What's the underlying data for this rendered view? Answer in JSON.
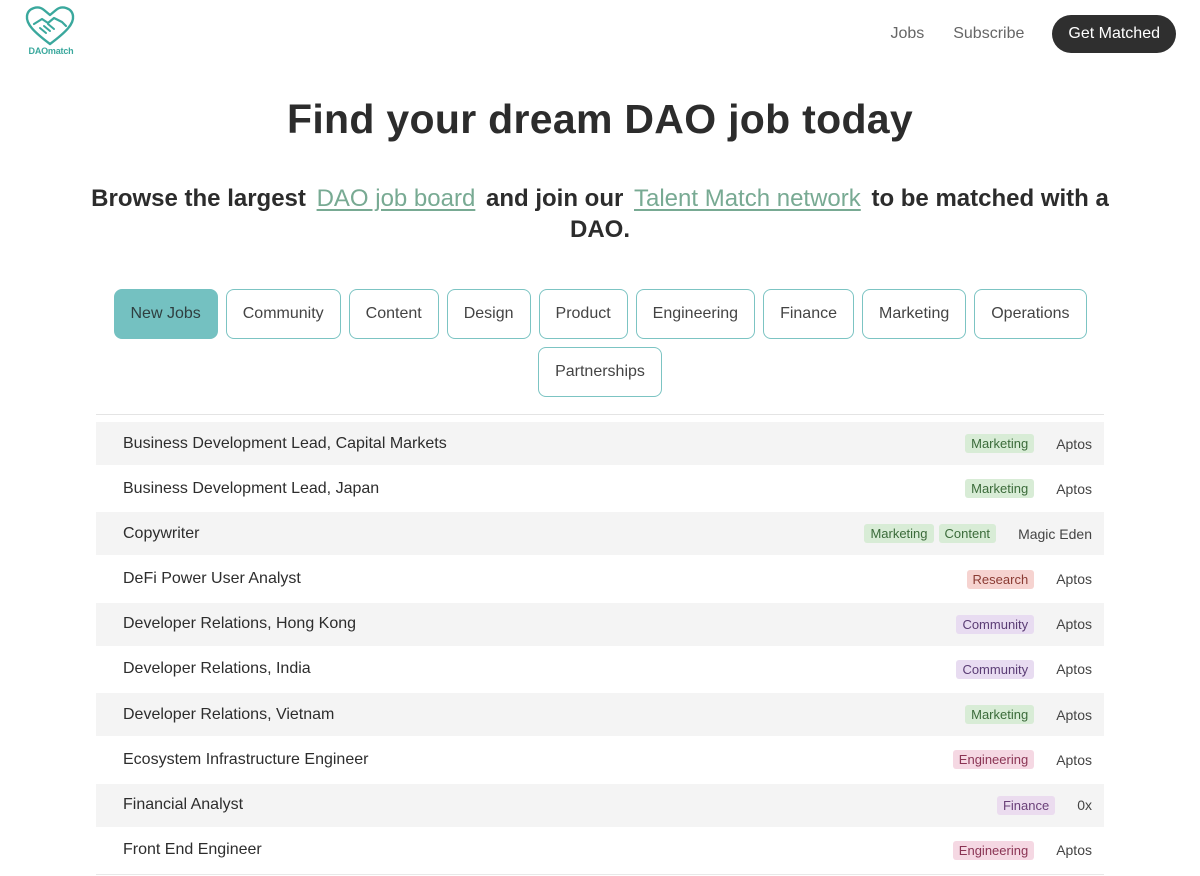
{
  "header": {
    "logo_text": "DAOmatch",
    "nav": [
      {
        "label": "Jobs"
      },
      {
        "label": "Subscribe"
      }
    ],
    "cta_label": "Get Matched"
  },
  "hero": {
    "title": "Find your dream DAO job today",
    "subtitle_part1": "Browse the largest",
    "link1": "DAO job board",
    "subtitle_part2": "and join our",
    "link2": "Talent Match network",
    "subtitle_part3": "to be matched with a DAO."
  },
  "filters": [
    {
      "label": "New Jobs",
      "active": true
    },
    {
      "label": "Community"
    },
    {
      "label": "Content"
    },
    {
      "label": "Design"
    },
    {
      "label": "Product"
    },
    {
      "label": "Engineering"
    },
    {
      "label": "Finance"
    },
    {
      "label": "Marketing"
    },
    {
      "label": "Operations"
    },
    {
      "label": "Partnerships"
    }
  ],
  "tag_colors": {
    "Marketing": {
      "bg": "#d8ecd6",
      "fg": "#3b6b3a"
    },
    "Content": {
      "bg": "#d8ecd6",
      "fg": "#3b6b3a"
    },
    "Research": {
      "bg": "#f6d3d0",
      "fg": "#8a3b33"
    },
    "Community": {
      "bg": "#e8dcf1",
      "fg": "#5b3d75"
    },
    "Engineering": {
      "bg": "#f5d8e3",
      "fg": "#8a3454"
    },
    "Finance": {
      "bg": "#ebdcef",
      "fg": "#6a3f78"
    }
  },
  "jobs": [
    {
      "title": "Business Development Lead, Capital Markets",
      "tags": [
        "Marketing"
      ],
      "company": "Aptos"
    },
    {
      "title": "Business Development Lead, Japan",
      "tags": [
        "Marketing"
      ],
      "company": "Aptos"
    },
    {
      "title": "Copywriter",
      "tags": [
        "Marketing",
        "Content"
      ],
      "company": "Magic Eden"
    },
    {
      "title": "DeFi Power User Analyst",
      "tags": [
        "Research"
      ],
      "company": "Aptos"
    },
    {
      "title": "Developer Relations, Hong Kong",
      "tags": [
        "Community"
      ],
      "company": "Aptos"
    },
    {
      "title": "Developer Relations, India",
      "tags": [
        "Community"
      ],
      "company": "Aptos"
    },
    {
      "title": "Developer Relations, Vietnam",
      "tags": [
        "Marketing"
      ],
      "company": "Aptos"
    },
    {
      "title": "Ecosystem Infrastructure Engineer",
      "tags": [
        "Engineering"
      ],
      "company": "Aptos"
    },
    {
      "title": "Financial Analyst",
      "tags": [
        "Finance"
      ],
      "company": "0x"
    },
    {
      "title": "Front End Engineer",
      "tags": [
        "Engineering"
      ],
      "company": "Aptos"
    }
  ]
}
